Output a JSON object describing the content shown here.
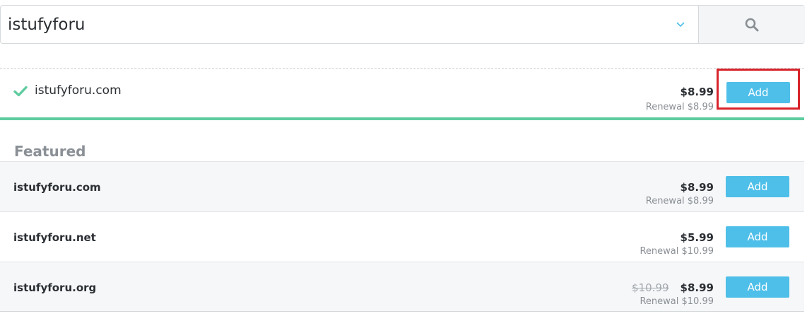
{
  "search": {
    "query": "istufyforu"
  },
  "icons": {
    "tld_toggle": "chevron-down-icon",
    "search": "search-icon",
    "available": "check-icon"
  },
  "colors": {
    "accent_button": "#4ebfe9",
    "available_green": "#5fcc9f",
    "highlight_red": "#d8232a"
  },
  "primary_result": {
    "domain": "istufyforu.com",
    "price": "$8.99",
    "renewal": "Renewal $8.99",
    "add_label": "Add"
  },
  "featured": {
    "title": "Featured",
    "items": [
      {
        "domain": "istufyforu.com",
        "old_price": "",
        "price": "$8.99",
        "renewal": "Renewal $8.99",
        "add_label": "Add"
      },
      {
        "domain": "istufyforu.net",
        "old_price": "",
        "price": "$5.99",
        "renewal": "Renewal $10.99",
        "add_label": "Add"
      },
      {
        "domain": "istufyforu.org",
        "old_price": "$10.99",
        "price": "$8.99",
        "renewal": "Renewal $10.99",
        "add_label": "Add"
      }
    ]
  }
}
